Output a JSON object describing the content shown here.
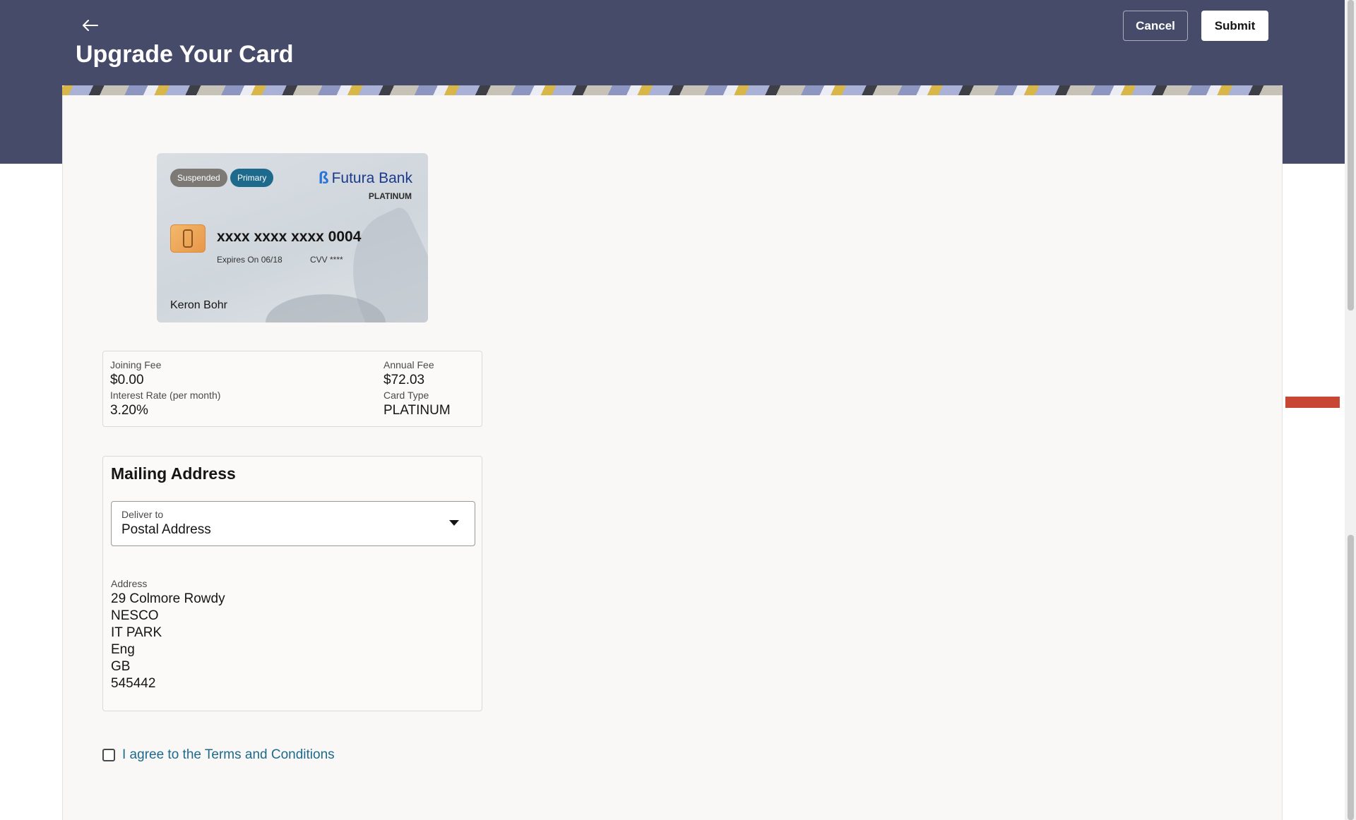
{
  "header": {
    "title": "Upgrade Your Card",
    "back_icon": "arrow-left-icon",
    "cancel_label": "Cancel",
    "submit_label": "Submit"
  },
  "colors": {
    "header_bg": "#474b6a",
    "panel_bg": "#f9f8f6",
    "link": "#1d6a8d",
    "primary_badge": "#1d6a8d",
    "suspended_badge": "#7d7a76",
    "side_marker": "#c74634"
  },
  "card": {
    "status_badge": "Suspended",
    "type_badge": "Primary",
    "bank_name": "Futura Bank",
    "tier": "PLATINUM",
    "number": "xxxx xxxx xxxx 0004",
    "expiry": "Expires On 06/18",
    "cvv": "CVV ****",
    "holder": "Keron Bohr"
  },
  "fees": {
    "joining_fee_label": "Joining Fee",
    "joining_fee_value": "$0.00",
    "annual_fee_label": "Annual Fee",
    "annual_fee_value": "$72.03",
    "interest_label": "Interest Rate (per month)",
    "interest_value": "3.20%",
    "card_type_label": "Card Type",
    "card_type_value": "PLATINUM"
  },
  "mailing": {
    "title": "Mailing Address",
    "deliver_label": "Deliver to",
    "deliver_value": "Postal Address",
    "address_label": "Address",
    "address_lines": [
      "29  Colmore Rowdy",
      "NESCO",
      "IT PARK",
      "Eng",
      "GB",
      "545442"
    ]
  },
  "terms": {
    "label": "I agree to the Terms and Conditions",
    "checked": false
  }
}
